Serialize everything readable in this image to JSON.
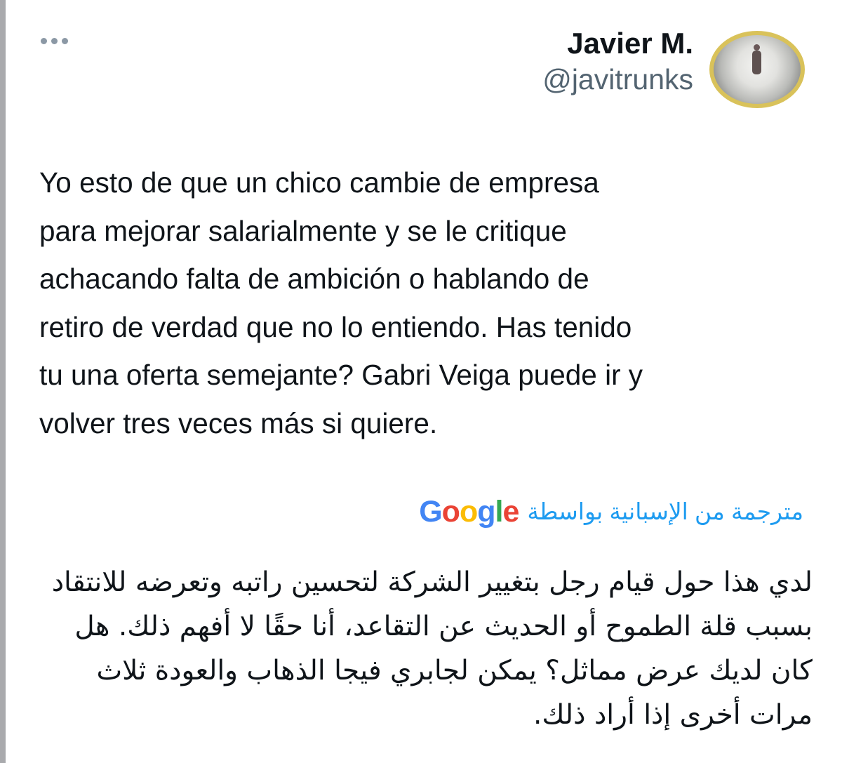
{
  "tweet": {
    "author": {
      "display_name": "Javier M.",
      "handle": "@javitrunks"
    },
    "more_icon": "more-horizontal-icon",
    "text": "Yo esto de que un chico cambie de empresa\npara mejorar salarialmente y se le critique\nachacando falta de ambición o hablando de\nretiro de verdad que no lo entiendo. Has tenido\ntu una oferta semejante? Gabri Veiga puede ir y\nvolver tres veces más si quiere.",
    "translation": {
      "label": "مترجمة من الإسبانية بواسطة",
      "provider": "Google",
      "text": "لدي هذا حول قيام رجل بتغيير الشركة لتحسين راتبه وتعرضه للانتقاد بسبب قلة الطموح أو الحديث عن التقاعد، أنا حقًا لا أفهم ذلك. هل كان لديك عرض مماثل؟ يمكن لجابري فيجا الذهاب والعودة ثلاث مرات أخرى إذا أراد ذلك."
    }
  },
  "colors": {
    "text_primary": "#0f1419",
    "text_secondary": "#536471",
    "link_blue": "#1d9bf0",
    "thread_line": "#a9aaad",
    "avatar_ring": "#d9c25a"
  }
}
